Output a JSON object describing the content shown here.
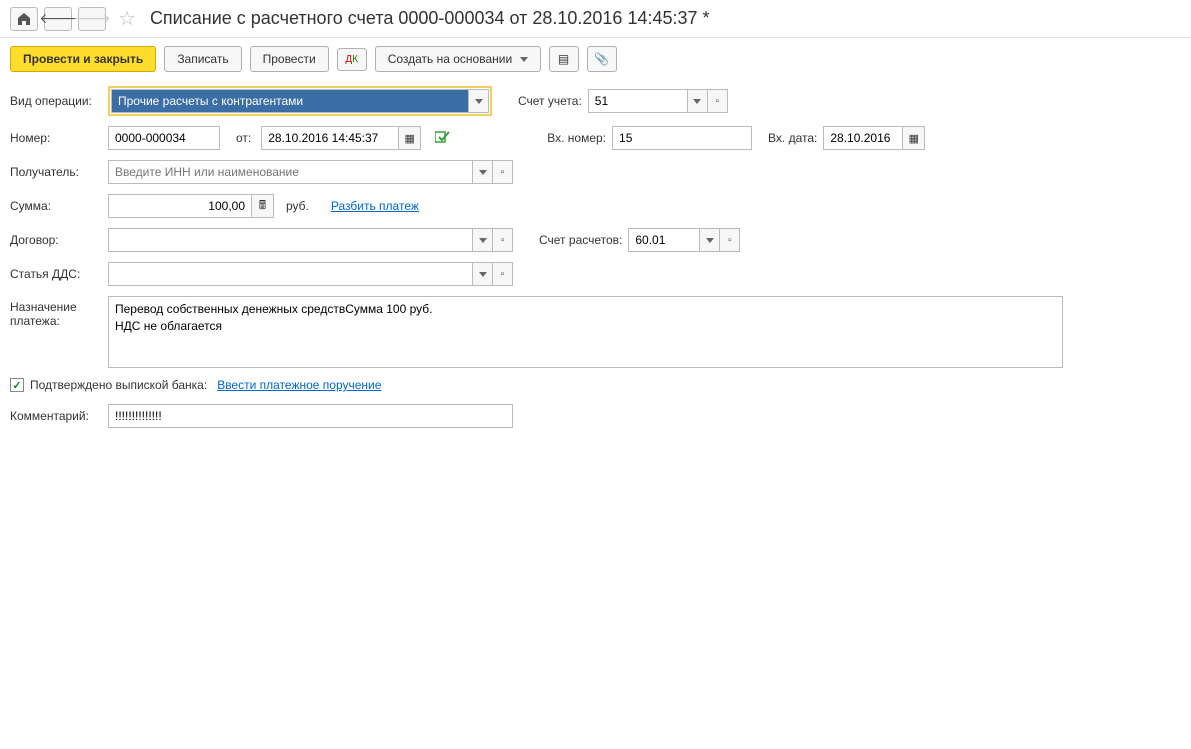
{
  "header": {
    "title": "Списание с расчетного счета 0000-000034 от 28.10.2016 14:45:37 *"
  },
  "toolbar": {
    "post_close": "Провести и закрыть",
    "save": "Записать",
    "post": "Провести",
    "create_based": "Создать на основании"
  },
  "labels": {
    "operation_type": "Вид операции:",
    "account": "Счет учета:",
    "number": "Номер:",
    "from": "от:",
    "incoming_number": "Вх. номер:",
    "incoming_date": "Вх. дата:",
    "recipient": "Получатель:",
    "amount": "Сумма:",
    "currency": "руб.",
    "split_payment": "Разбить платеж",
    "contract": "Договор:",
    "settlement_account": "Счет расчетов:",
    "dds_article": "Статья ДДС:",
    "payment_purpose": "Назначение платежа:",
    "confirmed_by_bank": "Подтверждено выпиской банка:",
    "enter_payment_order": "Ввести платежное поручение",
    "comment": "Комментарий:"
  },
  "values": {
    "operation_type": "Прочие расчеты с контрагентами",
    "account": "51",
    "number": "0000-000034",
    "date": "28.10.2016 14:45:37",
    "incoming_number": "15",
    "incoming_date": "28.10.2016",
    "recipient_placeholder": "Введите ИНН или наименование",
    "amount": "100,00",
    "settlement_account": "60.01",
    "payment_purpose": "Перевод собственных денежных средствСумма 100 руб.\nНДС не облагается",
    "comment": "!!!!!!!!!!!!!!"
  }
}
